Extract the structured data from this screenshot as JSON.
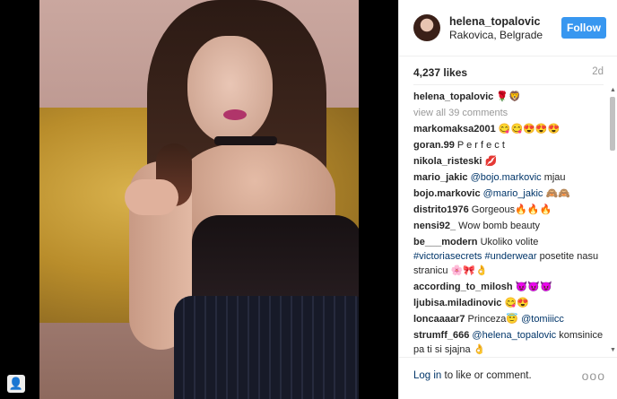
{
  "post": {
    "username": "helena_topalovic",
    "location": "Rakovica, Belgrade",
    "follow_label": "Follow",
    "likes": "4,237 likes",
    "age": "2d",
    "caption_user": "helena_topalovic",
    "caption_text": "🌹🦁",
    "view_all": "view all 39 comments"
  },
  "comments": [
    {
      "user": "markomaksa2001",
      "text": " 😋😋😍😍😍"
    },
    {
      "user": "goran.99",
      "text": " P e r f e c t"
    },
    {
      "user": "nikola_risteski",
      "text": " 💋"
    },
    {
      "user": "mario_jakic",
      "mention": "@bojo.markovic",
      "text": " mjau"
    },
    {
      "user": "bojo.markovic",
      "mention": "@mario_jakic",
      "text": " 🙈🙈"
    },
    {
      "user": "distrito1976",
      "text": " Gorgeous🔥🔥🔥"
    },
    {
      "user": "nensi92_",
      "text": " Wow bomb beauty"
    },
    {
      "user": "be___modern",
      "text": " Ukoliko volite ",
      "tags": "#victoriasecrets #underwear",
      "text2": " posetite nasu stranicu 🌸🎀👌"
    },
    {
      "user": "according_to_milosh",
      "text": " 😈😈😈"
    },
    {
      "user": "ljubisa.miladinovic",
      "text": " 😋😍"
    },
    {
      "user": "loncaaaar7",
      "text": " Princeza😇 ",
      "mention2": "@tomiiicc"
    },
    {
      "user": "strumff_666",
      "mention": "@helena_topalovic",
      "text": " komsinice pa ti si sjajna 👌"
    }
  ],
  "footer": {
    "login_link": "Log in",
    "login_text": " to like or comment.",
    "more": "ooo"
  },
  "icons": {
    "corner": "profile-icon"
  }
}
